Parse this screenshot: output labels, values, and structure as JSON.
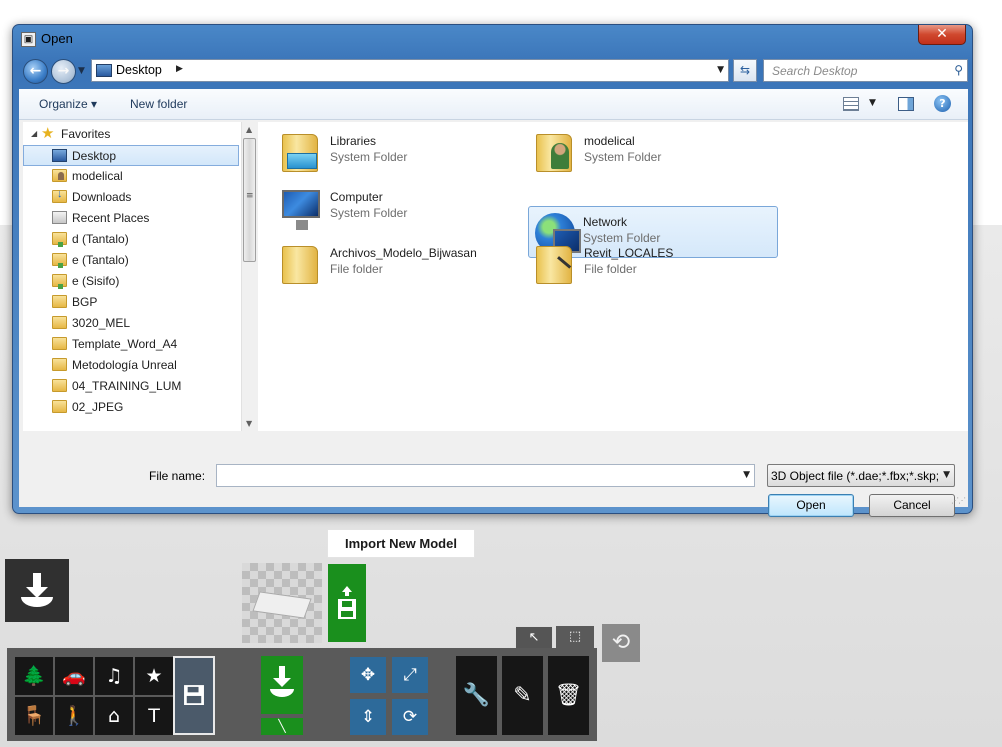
{
  "dialog": {
    "title": "Open",
    "close_label": "✕",
    "address": {
      "location": "Desktop"
    },
    "search": {
      "placeholder": "Search Desktop"
    },
    "toolbar": {
      "organize": "Organize ▾",
      "new_folder": "New folder",
      "help": "?"
    },
    "nav_tree": [
      {
        "label": "Favorites",
        "icon": "star-icon",
        "expander": "◢"
      },
      {
        "label": "Desktop",
        "icon": "desktop-icon",
        "selected": true
      },
      {
        "label": "modelical",
        "icon": "user-folder-icon"
      },
      {
        "label": "Downloads",
        "icon": "downloads-folder-icon"
      },
      {
        "label": "Recent Places",
        "icon": "recent-places-icon"
      },
      {
        "label": "d (Tantalo)",
        "icon": "network-folder-icon"
      },
      {
        "label": "e (Tantalo)",
        "icon": "network-folder-icon"
      },
      {
        "label": "e (Sisifo)",
        "icon": "network-folder-icon"
      },
      {
        "label": "BGP",
        "icon": "folder-icon"
      },
      {
        "label": "3020_MEL",
        "icon": "folder-icon"
      },
      {
        "label": "Template_Word_A4",
        "icon": "folder-icon"
      },
      {
        "label": "Metodología Unreal",
        "icon": "folder-icon"
      },
      {
        "label": "04_TRAINING_LUM",
        "icon": "folder-icon"
      },
      {
        "label": "02_JPEG",
        "icon": "folder-icon"
      }
    ],
    "files": [
      {
        "name": "Libraries",
        "type": "System Folder",
        "icon": "libraries-icon"
      },
      {
        "name": "modelical",
        "type": "System Folder",
        "icon": "user-folder-icon"
      },
      {
        "name": "Computer",
        "type": "System Folder",
        "icon": "computer-icon"
      },
      {
        "name": "Network",
        "type": "System Folder",
        "icon": "network-icon",
        "selected": true
      },
      {
        "name": "Archivos_Modelo_Bijwasan",
        "type": "File folder",
        "icon": "folder-icon"
      },
      {
        "name": "Revit_LOCALES",
        "type": "File folder",
        "icon": "shortcut-folder-icon"
      }
    ],
    "file_name_label": "File name:",
    "file_name_value": "",
    "file_type_filter": "3D Object file (*.dae;*.fbx;*.skp;",
    "open_label": "Open",
    "cancel_label": "Cancel"
  },
  "app": {
    "tooltip": "Import New Model",
    "category_buttons": [
      {
        "name": "tree-icon",
        "glyph": "🌲"
      },
      {
        "name": "car-icon",
        "glyph": "🚗"
      },
      {
        "name": "music-note-icon",
        "glyph": "♫"
      },
      {
        "name": "stars-icon",
        "glyph": "★"
      },
      {
        "name": "chair-icon",
        "glyph": "🪑"
      },
      {
        "name": "walking-person-icon",
        "glyph": "🚶"
      },
      {
        "name": "house-icon",
        "glyph": "⌂"
      },
      {
        "name": "text-wrench-icon",
        "glyph": "T"
      }
    ],
    "transform_buttons": [
      {
        "name": "move-icon",
        "glyph": "✥"
      },
      {
        "name": "scale-icon",
        "glyph": "⤢"
      },
      {
        "name": "vertical-move-icon",
        "glyph": "⇕"
      },
      {
        "name": "rotate-icon",
        "glyph": "⟳"
      }
    ],
    "action_buttons": [
      {
        "name": "wrench-icon",
        "glyph": "🔧"
      },
      {
        "name": "pencil-icon",
        "glyph": "✎"
      },
      {
        "name": "trash-icon",
        "glyph": "🗑"
      }
    ],
    "mode_tabs": [
      {
        "name": "pointer-icon",
        "glyph": "↖"
      },
      {
        "name": "marquee-select-icon",
        "glyph": "⬚"
      }
    ],
    "refresh_glyph": "⟲",
    "colors": {
      "green": "#1a8f1d",
      "blue": "#2d6a9a",
      "dark": "#161616",
      "panel": "#5a5a5a"
    }
  }
}
